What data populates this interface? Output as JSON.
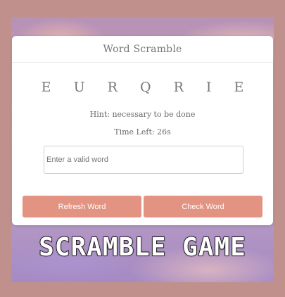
{
  "game": {
    "title": "Word Scramble",
    "scrambled_word": "E U R Q R I E",
    "hint": "Hint: necessary to be done",
    "timer": "Time Left: 26s",
    "input": {
      "placeholder": "Enter a valid word",
      "value": ""
    },
    "buttons": {
      "refresh": "Refresh Word",
      "check": "Check Word"
    }
  },
  "banner": {
    "text": "SCRAMBLE GAME"
  },
  "colors": {
    "button_bg": "#e39381",
    "card_bg": "#ffffff",
    "page_bg": "#c0918c"
  }
}
